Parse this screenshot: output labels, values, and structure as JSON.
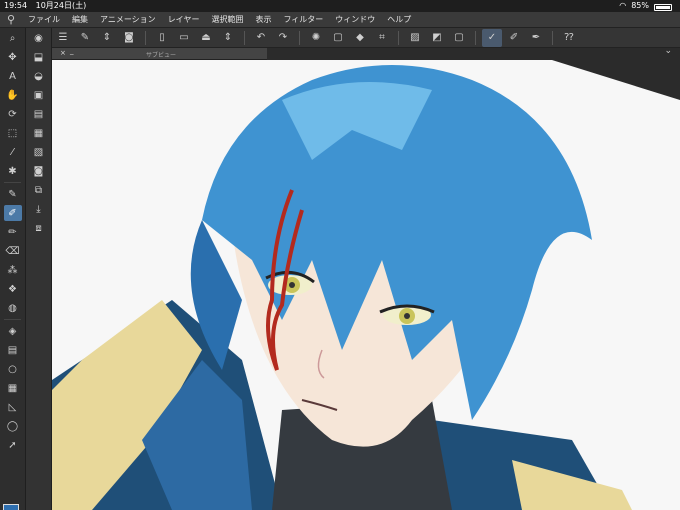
{
  "status": {
    "time": "19:54",
    "date": "10月24日(土)",
    "battery": "85%",
    "battery_level": 0.85
  },
  "menu": {
    "items": [
      "ファイル",
      "編集",
      "アニメーション",
      "レイヤー",
      "選択範囲",
      "表示",
      "フィルター",
      "ウィンドウ",
      "ヘルプ"
    ]
  },
  "toolbar": {
    "icons": [
      "menu-icon",
      "edit-doc-icon",
      "stepper-icon",
      "preview-icon",
      "new-file-icon",
      "open-folder-icon",
      "save-icon",
      "stepper2-icon",
      "undo-icon",
      "redo-icon",
      "loading-icon",
      "clear-icon",
      "fill-icon",
      "transform-icon",
      "deselect-icon",
      "invert-icon",
      "selection-icon",
      "ruler-pen-icon",
      "brush-icon",
      "pen-icon",
      "help-icon"
    ]
  },
  "subview": {
    "title": "サブビュー",
    "close": "×",
    "minimize": "_"
  },
  "tools_left": [
    "zoom",
    "move",
    "text",
    "hand",
    "rotate",
    "select",
    "eyedropper",
    "wand",
    "pen",
    "brush-active",
    "pencil",
    "eraser",
    "fill",
    "decoration",
    "blend",
    "bucket",
    "gradient",
    "ellipse",
    "frame",
    "ruler",
    "speech",
    "object"
  ],
  "tools_right": [
    "navigator",
    "layer-props",
    "color",
    "layer",
    "material",
    "history",
    "auto-action",
    "camera",
    "layers-stack",
    "import",
    "stack"
  ],
  "colors": {
    "main": "#2e6fb0",
    "sub": "#ffffff"
  }
}
